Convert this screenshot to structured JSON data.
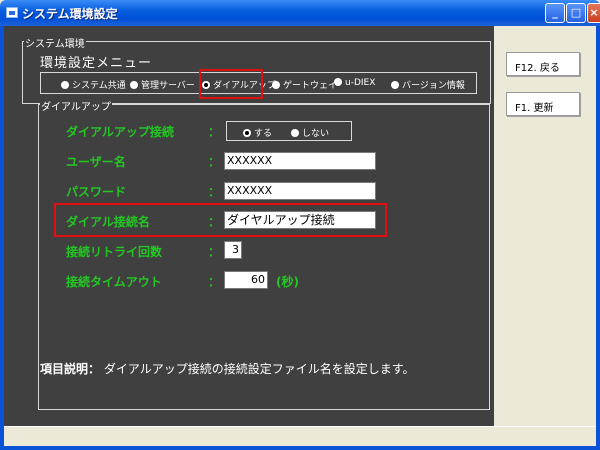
{
  "window": {
    "title": "システム環境設定"
  },
  "group_system": {
    "title": "システム環境"
  },
  "menu": {
    "heading": "環境設定メニュー",
    "tabs": [
      {
        "label": "システム共通",
        "selected": false
      },
      {
        "label": "管理サーバー",
        "selected": false
      },
      {
        "label": "ダイアルアップ",
        "selected": true
      },
      {
        "label": "ゲートウェイ",
        "selected": false
      },
      {
        "label": "u-DIEX",
        "selected": false
      },
      {
        "label": "バージョン情報",
        "selected": false
      }
    ]
  },
  "dialup": {
    "group_title": "ダイアルアップ",
    "colon": "：",
    "connect": {
      "label": "ダイアルアップ接続",
      "opt_yes": "する",
      "opt_no": "しない",
      "selected": "する"
    },
    "username": {
      "label": "ユーザー名",
      "value": "XXXXXX"
    },
    "password": {
      "label": "パスワード",
      "value": "XXXXXX"
    },
    "connection_name": {
      "label": "ダイアル接続名",
      "value": "ダイヤルアップ接続"
    },
    "retry": {
      "label": "接続リトライ回数",
      "value": "3"
    },
    "timeout": {
      "label": "接続タイムアウト",
      "value": "60",
      "unit": "(秒)"
    }
  },
  "description": {
    "label": "項目説明：",
    "text": "ダイアルアップ接続の接続設定ファイル名を設定します。"
  },
  "buttons": {
    "back": "F12. 戻る",
    "update": "F1. 更新"
  },
  "colors": {
    "panel_bg": "#404040",
    "label_green": "#22c722",
    "highlight_red": "#e01010",
    "titlebar_blue": "#0a5fe0"
  }
}
